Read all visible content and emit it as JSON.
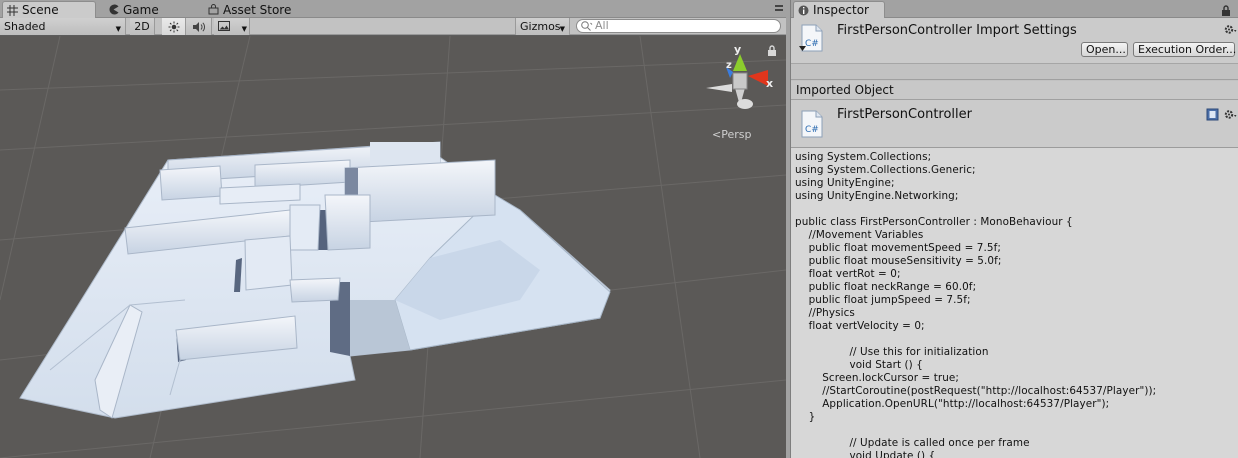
{
  "scene_panel": {
    "tabs": [
      {
        "label": "Scene",
        "icon": "scene-grid-icon",
        "active": true
      },
      {
        "label": "Game",
        "icon": "game-pacman-icon",
        "active": false
      },
      {
        "label": "Asset Store",
        "icon": "asset-store-bag-icon",
        "active": false
      }
    ],
    "toolbar": {
      "shading_mode": "Shaded",
      "mode_2d": "2D",
      "lighting_icon": "sun-icon",
      "audio_icon": "speaker-icon",
      "effects_icon": "image-icon",
      "gizmos_label": "Gizmos",
      "search_placeholder": "All"
    },
    "gizmo": {
      "y_label": "y",
      "z_label": "z",
      "x_label": "x",
      "projection_label": "Persp",
      "colors": {
        "x": "#e0361c",
        "y": "#8ccd2d",
        "z": "#3a7de0"
      }
    }
  },
  "inspector": {
    "tab_label": "Inspector",
    "lock_icon": "lock-icon",
    "header": {
      "title": "FirstPersonController Import Settings",
      "icon": "csharp-file-icon",
      "open_button": "Open...",
      "execution_order_button": "Execution Order..."
    },
    "imported_object_label": "Imported Object",
    "object_name": "FirstPersonController",
    "code_lines": [
      "using System.Collections;",
      "using System.Collections.Generic;",
      "using UnityEngine;",
      "using UnityEngine.Networking;",
      "",
      "public class FirstPersonController : MonoBehaviour {",
      "    //Movement Variables",
      "    public float movementSpeed = 7.5f;",
      "    public float mouseSensitivity = 5.0f;",
      "    float vertRot = 0;",
      "    public float neckRange = 60.0f;",
      "    public float jumpSpeed = 7.5f;",
      "    //Physics",
      "    float vertVelocity = 0;",
      "",
      "                // Use this for initialization",
      "                void Start () {",
      "        Screen.lockCursor = true;",
      "        //StartCoroutine(postRequest(\"http://localhost:64537/Player\"));",
      "        Application.OpenURL(\"http://localhost:64537/Player\");",
      "    }",
      "",
      "                // Update is called once per frame",
      "                void Update () {"
    ]
  }
}
